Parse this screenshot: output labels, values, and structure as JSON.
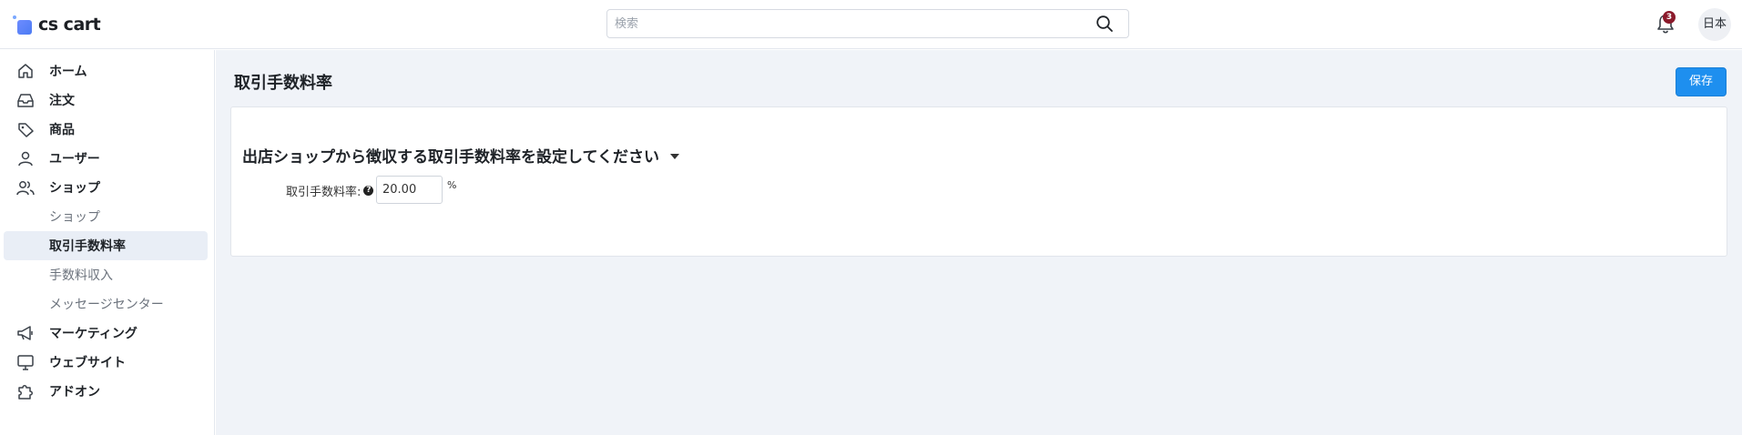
{
  "app": {
    "logo_text": "cs cart",
    "brand_color": "#4c7bf3"
  },
  "header": {
    "search_placeholder": "検索",
    "search_value": "",
    "notification_count": "3",
    "language_label": "日本",
    "icons": [
      "search-icon",
      "bell-icon"
    ]
  },
  "sidebar": {
    "items": [
      {
        "label": "ホーム",
        "icon": "home-icon"
      },
      {
        "label": "注文",
        "icon": "inbox-icon"
      },
      {
        "label": "商品",
        "icon": "tag-icon"
      },
      {
        "label": "ユーザー",
        "icon": "user-icon"
      },
      {
        "label": "ショップ",
        "icon": "users-icon"
      },
      {
        "label": "ショップ",
        "sub": true
      },
      {
        "label": "取引手数料率",
        "sub": true,
        "active": true
      },
      {
        "label": "手数料収入",
        "sub": true
      },
      {
        "label": "メッセージセンター",
        "sub": true
      },
      {
        "label": "マーケティング",
        "icon": "megaphone-icon"
      },
      {
        "label": "ウェブサイト",
        "icon": "monitor-icon"
      },
      {
        "label": "アドオン",
        "icon": "puzzle-icon"
      }
    ]
  },
  "main": {
    "page_title": "取引手数料率",
    "save_label": "保存",
    "section_title": "出店ショップから徴収する取引手数料率を設定してください",
    "field_label": "取引手数料率:",
    "field_value": "20.00",
    "field_unit": "%",
    "accent_color": "#1e8fef"
  }
}
